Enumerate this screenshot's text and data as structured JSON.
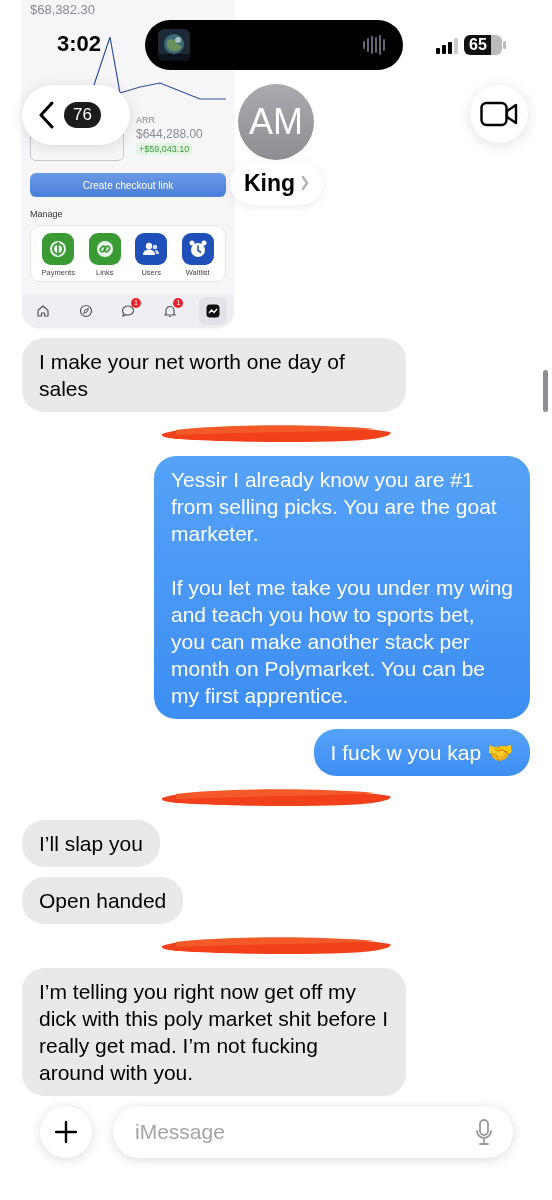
{
  "status_bar": {
    "time": "3:02",
    "battery": "65"
  },
  "header": {
    "back_count": "76",
    "avatar_initials": "AM",
    "contact_name": "King"
  },
  "attachment": {
    "kind": "screenshot",
    "balance": "$68,382.30",
    "stat": {
      "label": "ARR",
      "value": "$644,288.00",
      "change": "+$59,043.10"
    },
    "button": "Create checkout link",
    "section": "Manage",
    "apps": [
      {
        "kind": "coin",
        "label": "Payments",
        "color": "#3a9b35"
      },
      {
        "kind": "link",
        "label": "Links",
        "color": "#3a9b35"
      },
      {
        "kind": "people",
        "label": "Users",
        "color": "#1f4fb8"
      },
      {
        "kind": "alarm",
        "label": "Waitlist",
        "color": "#1f4fb8"
      }
    ],
    "tabs": [
      {
        "kind": "home",
        "selected": false
      },
      {
        "kind": "compass",
        "selected": false
      },
      {
        "kind": "chat",
        "selected": false,
        "badge": "1"
      },
      {
        "kind": "bell",
        "selected": false,
        "badge": "1"
      },
      {
        "kind": "chart",
        "selected": true
      }
    ]
  },
  "messages": [
    {
      "kind": "incoming",
      "text": "I make your net worth one day of sales"
    },
    {
      "kind": "redaction"
    },
    {
      "kind": "outgoing",
      "text": "Yessir I already know you are #1 from selling picks. You are the goat marketer.\n\nIf you let me take you under my wing and teach you how to sports bet, you can make another stack per month on Polymarket. You can be my first apprentice."
    },
    {
      "kind": "outgoing",
      "text": "I fuck w you kap 🤝"
    },
    {
      "kind": "redaction"
    },
    {
      "kind": "incoming",
      "text": "I’ll slap you"
    },
    {
      "kind": "incoming",
      "text": "Open handed"
    },
    {
      "kind": "redaction"
    },
    {
      "kind": "incoming",
      "text": "I’m telling you right now get off my dick with this poly market shit before I really get mad. I’m not fucking around with you."
    }
  ],
  "composer": {
    "placeholder": "iMessage"
  }
}
